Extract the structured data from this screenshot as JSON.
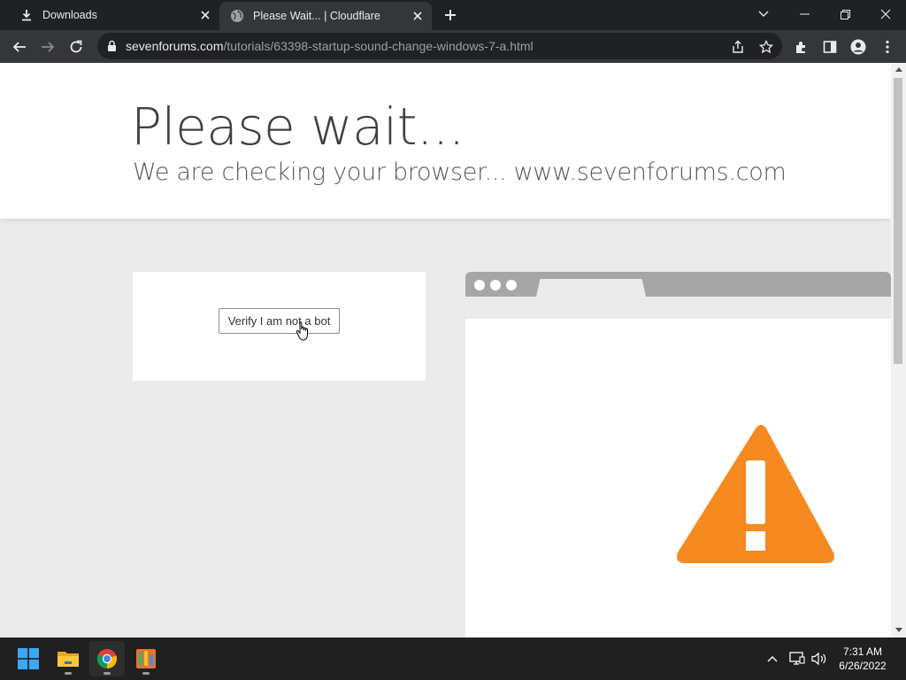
{
  "browser": {
    "tabs": [
      {
        "title": "Downloads",
        "icon": "download-icon",
        "active": false
      },
      {
        "title": "Please Wait... | Cloudflare",
        "icon": "globe-icon",
        "active": true
      }
    ],
    "address": {
      "host": "sevenforums.com",
      "path": "/tutorials/63398-startup-sound-change-windows-7-a.html"
    }
  },
  "page": {
    "headline": "Please wait...",
    "subheadline": "We are checking your browser... www.sevenforums.com",
    "verify_button_label": "Verify I am not a bot"
  },
  "taskbar": {
    "apps": [
      "start-icon",
      "file-explorer-icon",
      "chrome-icon",
      "app-icon"
    ],
    "time": "7:31 AM",
    "date": "6/26/2022"
  },
  "colors": {
    "warning": "#f6891f",
    "chrome_dark": "#202124",
    "toolbar": "#35363a"
  }
}
